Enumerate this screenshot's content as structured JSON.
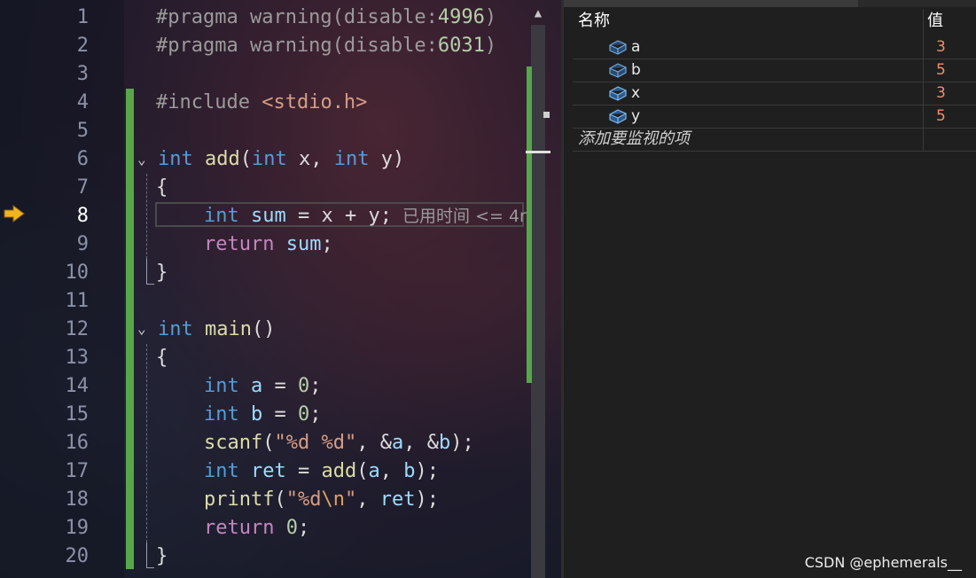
{
  "editor": {
    "line_numbers": [
      "1",
      "2",
      "3",
      "4",
      "5",
      "6",
      "7",
      "8",
      "9",
      "10",
      "11",
      "12",
      "13",
      "14",
      "15",
      "16",
      "17",
      "18",
      "19",
      "20"
    ],
    "current_line": "8",
    "lines": {
      "l1": {
        "a": "#pragma warning(disable:",
        "b": "4996",
        ")": ")"
      },
      "l2": {
        "a": "#pragma warning(disable:",
        "b": "6031",
        ")": ")"
      },
      "l4": {
        "a": "#include ",
        "b": "<stdio.h>"
      },
      "l6": {
        "kw1": "int",
        "fn": " add",
        "p1": "(",
        "kw2": "int",
        "v1": " x, ",
        "kw3": "int",
        "v2": " y",
        ")": ")"
      },
      "l7": {
        "t": "{"
      },
      "l8": {
        "kw": "int",
        "v": " sum",
        "op": " = x + y;",
        "hint": "  已用时间 <= 4r"
      },
      "l9": {
        "kw": "return",
        "v": " sum",
        ";": ";"
      },
      "l10": {
        "t": "}"
      },
      "l12": {
        "kw": "int",
        "fn": " main",
        "p": "()"
      },
      "l13": {
        "t": "{"
      },
      "l14": {
        "kw": "int",
        "v": " a",
        "op": " = ",
        "n": "0",
        ";": ";"
      },
      "l15": {
        "kw": "int",
        "v": " b",
        "op": " = ",
        "n": "0",
        ";": ";"
      },
      "l16": {
        "fn": "scanf",
        "p": "(",
        "s": "\"%d %d\"",
        "r": ", &",
        "v1": "a",
        ", &": ", &",
        "v2": "b",
        ")": ");"
      },
      "l17": {
        "kw": "int",
        "v": " ret",
        "op": " = ",
        "fn": "add",
        "p": "(",
        "v1": "a",
        ",": ", ",
        "v2": "b",
        ")": ");"
      },
      "l18": {
        "fn": "printf",
        "p": "(",
        "s1": "\"%d",
        "esc": "\\n",
        "s2": "\"",
        ",": ", ",
        "v": "ret",
        ")": ");"
      },
      "l19": {
        "kw": "return",
        "sp": " ",
        "n": "0",
        ";": ";"
      },
      "l20": {
        "t": "}"
      }
    }
  },
  "watch": {
    "header_name": "名称",
    "header_value": "值",
    "items": [
      {
        "name": "a",
        "value": "3"
      },
      {
        "name": "b",
        "value": "5"
      },
      {
        "name": "x",
        "value": "3"
      },
      {
        "name": "y",
        "value": "5"
      }
    ],
    "add_placeholder": "添加要监视的项"
  },
  "watermark": "CSDN @ephemerals__",
  "colors": {
    "change_bar": "#57a64a",
    "value": "#f08d70",
    "keyword": "#569cd6",
    "function": "#dcdcaa"
  },
  "icons": {
    "exec": "execution-arrow-icon",
    "var": "variable-cube-icon"
  }
}
